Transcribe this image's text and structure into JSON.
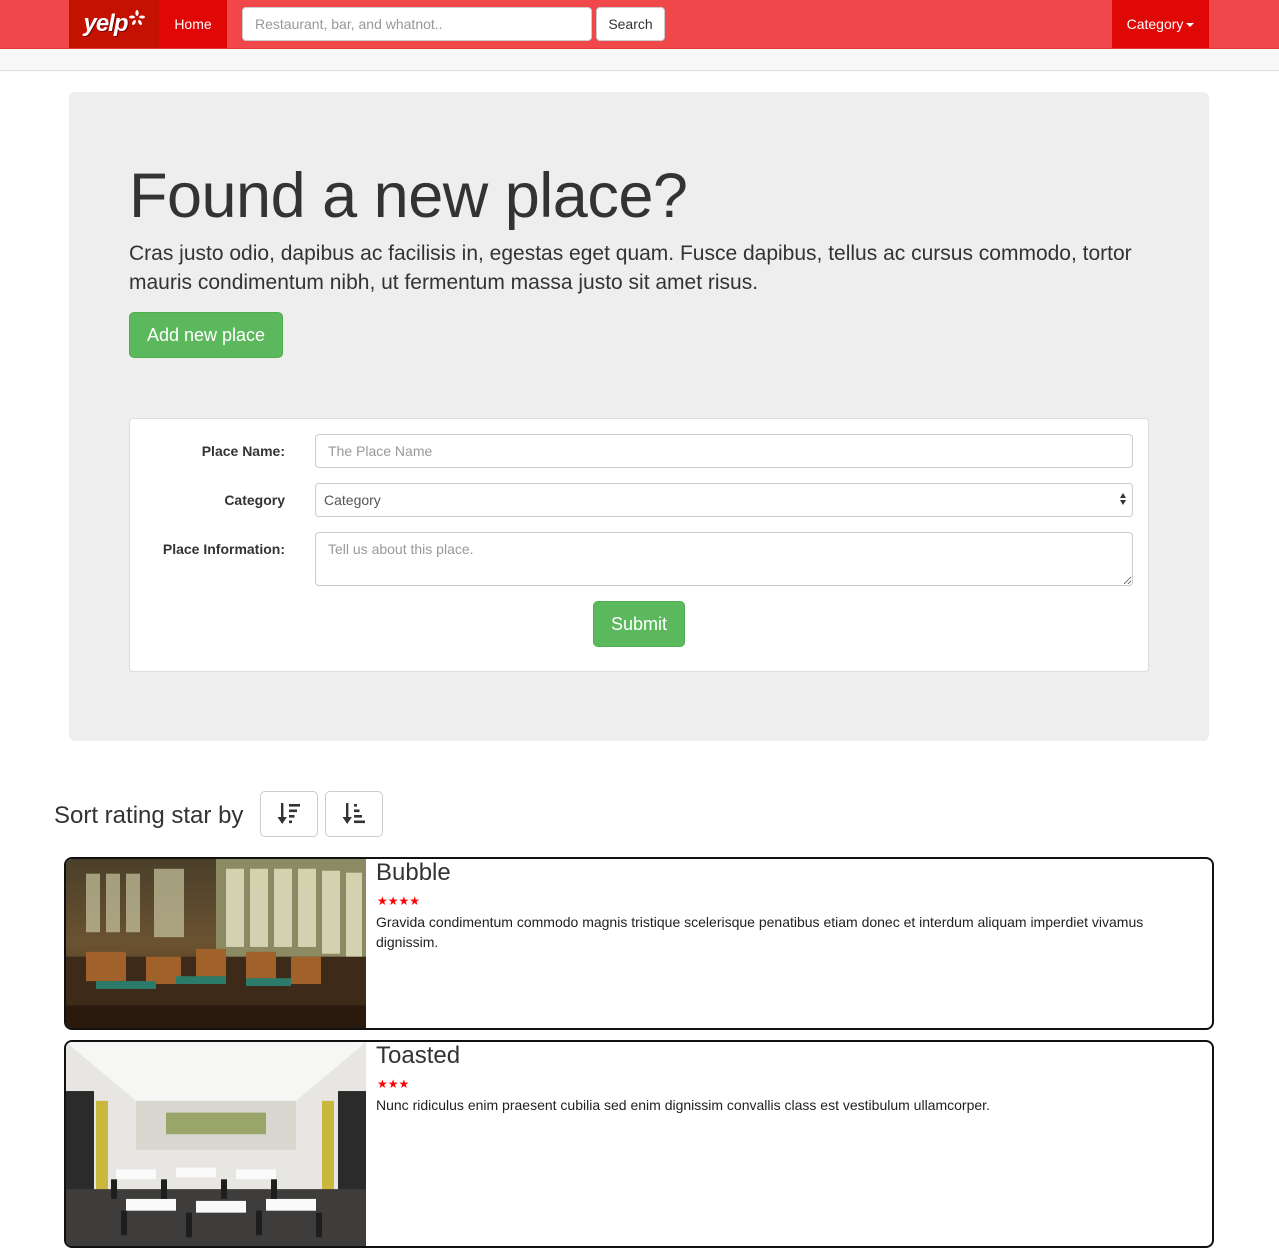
{
  "navbar": {
    "logo_text": "yelp",
    "home_label": "Home",
    "search_placeholder": "Restaurant, bar, and whatnot..",
    "search_button": "Search",
    "category_label": "Category"
  },
  "hero": {
    "title": "Found a new place?",
    "text": "Cras justo odio, dapibus ac facilisis in, egestas eget quam. Fusce dapibus, tellus ac cursus commodo, tortor mauris condimentum nibh, ut fermentum massa justo sit amet risus.",
    "add_button": "Add new place"
  },
  "form": {
    "name_label": "Place Name:",
    "name_placeholder": "The Place Name",
    "category_label": "Category",
    "category_value": "Category",
    "info_label": "Place Information:",
    "info_placeholder": "Tell us about this place.",
    "submit_label": "Submit"
  },
  "sort": {
    "label": "Sort rating star by"
  },
  "places": [
    {
      "name": "Bubble",
      "rating": 4,
      "stars": "★★★★",
      "description": "Gravida condimentum commodo magnis tristique scelerisque penatibus etiam donec et interdum aliquam imperdiet vivamus dignissim."
    },
    {
      "name": "Toasted",
      "rating": 3,
      "stars": "★★★",
      "description": "Nunc ridiculus enim praesent cubilia sed enim dignissim convallis class est vestibulum ullamcorper."
    }
  ],
  "colors": {
    "navbar": "#f0474a",
    "nav_active": "#e00707",
    "logo_bg": "#c41200",
    "success": "#5cb85c",
    "star": "#ff0000"
  }
}
